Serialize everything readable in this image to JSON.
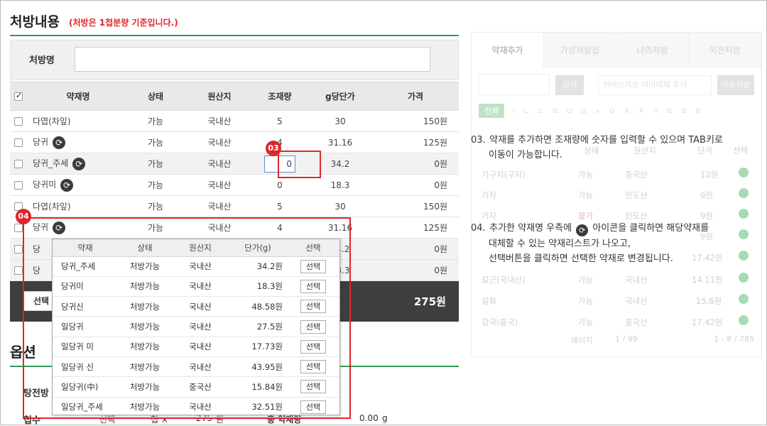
{
  "header": {
    "title": "처방내용",
    "note": "(처방은 1첩분량 기준입니다.)"
  },
  "name_field": {
    "label": "처방명",
    "value": ""
  },
  "table": {
    "columns": [
      "약재명",
      "상태",
      "원산지",
      "조재량",
      "g당단가",
      "가격"
    ],
    "rows": [
      {
        "name": "다엽(차잎)",
        "status": "가능",
        "origin": "국내산",
        "amount": "5",
        "unit_price": "30",
        "price": "150원"
      },
      {
        "name": "당귀",
        "status": "가능",
        "origin": "국내산",
        "amount": "4",
        "unit_price": "31.16",
        "price": "125원"
      },
      {
        "name": "당귀_주세",
        "status": "가능",
        "origin": "국내산",
        "amount": "0",
        "unit_price": "34.2",
        "price": "0원"
      },
      {
        "name": "당귀미",
        "status": "가능",
        "origin": "국내산",
        "amount": "0",
        "unit_price": "18.3",
        "price": "0원"
      },
      {
        "name": "다엽(차잎)",
        "status": "가능",
        "origin": "국내산",
        "amount": "5",
        "unit_price": "30",
        "price": "150원"
      },
      {
        "name": "당귀",
        "status": "가능",
        "origin": "국내산",
        "amount": "4",
        "unit_price": "31.16",
        "price": "125원"
      },
      {
        "name": "당",
        "status": "",
        "origin": "",
        "amount": "",
        "unit_price": "34.2",
        "price": "0원"
      },
      {
        "name": "당",
        "status": "",
        "origin": "",
        "amount": "",
        "unit_price": "18.3",
        "price": "0원"
      }
    ]
  },
  "total_bar": {
    "select_label": "선택",
    "total": "275원"
  },
  "popup": {
    "columns": [
      "약재",
      "상태",
      "원산지",
      "단가(g)",
      "선택"
    ],
    "rows": [
      {
        "name": "당귀_주세",
        "status": "처방가능",
        "origin": "국내산",
        "price": "34.2원",
        "button": "선택"
      },
      {
        "name": "당귀미",
        "status": "처방가능",
        "origin": "국내산",
        "price": "18.3원",
        "button": "선택"
      },
      {
        "name": "당귀신",
        "status": "처방가능",
        "origin": "국내산",
        "price": "48.58원",
        "button": "선택"
      },
      {
        "name": "일당귀",
        "status": "처방가능",
        "origin": "국내산",
        "price": "27.5원",
        "button": "선택"
      },
      {
        "name": "일당귀 미",
        "status": "처방가능",
        "origin": "국내산",
        "price": "17.73원",
        "button": "선택"
      },
      {
        "name": "일당귀 신",
        "status": "처방가능",
        "origin": "국내산",
        "price": "43.95원",
        "button": "선택"
      },
      {
        "name": "일당귀(中)",
        "status": "처방가능",
        "origin": "중국산",
        "price": "15.84원",
        "button": "선택"
      },
      {
        "name": "일당귀_주세",
        "status": "처방가능",
        "origin": "국내산",
        "price": "32.51원",
        "button": "선택"
      }
    ]
  },
  "options": {
    "title": "옵션",
    "decoction_label": "탕전방",
    "count_label": "첩수",
    "select_text": "선택",
    "mult_text": "첩 ×",
    "value_275": "275",
    "unit_won": "원",
    "amount_label": "총 약재량",
    "amount_value": "0.00",
    "amount_unit": "g"
  },
  "annotations": {
    "badge_03": "03",
    "badge_04": "04"
  },
  "notes": {
    "note03": {
      "number": "03.",
      "line1": "약재를 추가하면 조재량에 숫자를 입력할 수 있으며 TAB키로",
      "line2": "이동이 가능합니다."
    },
    "note04": {
      "number": "04.",
      "line1_a": "추가한 약재명 우측에",
      "line1_b": "아이콘을 클릭하면 해당약재를",
      "line2": "대체할 수 있는 약재리스트가 나오고,",
      "line3": "선택버튼을 클릭하면 선택한 약재로 변경됩니다."
    }
  },
  "side_panel": {
    "tabs": [
      "약재추가",
      "가성처방집",
      "나의처방",
      "이전처방"
    ],
    "search_button": "검색",
    "search_placeholder": "띄어쓰기로 여러약재 추가",
    "direct_button": "바로처방",
    "alpha_all": "전체",
    "alphabet": [
      "ㄱ",
      "ㄴ",
      "ㄷ",
      "ㄹ",
      "ㅁ",
      "ㅂ",
      "ㅅ",
      "ㅇ",
      "ㅈ",
      "ㅊ",
      "ㅋ",
      "ㅌ",
      "ㅍ",
      "ㅎ"
    ],
    "list_header": [
      "상태",
      "원산지",
      "단가",
      "선택"
    ],
    "rows": [
      {
        "name": "가구자(구자)",
        "status": "가능",
        "origin": "중국산",
        "price": "12원"
      },
      {
        "name": "가자",
        "status": "가능",
        "origin": "인도산",
        "price": "9원"
      },
      {
        "name": "가자",
        "status": "불가",
        "origin": "인도산",
        "price": "9원"
      },
      {
        "name": "",
        "status": "",
        "origin": "",
        "price": "9원"
      },
      {
        "name": "",
        "status": "",
        "origin": "",
        "price": "17.42원"
      },
      {
        "name": "갈근(국내산)",
        "status": "가능",
        "origin": "국내산",
        "price": "14.11원"
      },
      {
        "name": "갈화",
        "status": "가능",
        "origin": "국내산",
        "price": "15.6원"
      },
      {
        "name": "감국(중국)",
        "status": "가능",
        "origin": "중국산",
        "price": "17.42원"
      }
    ],
    "page_label": "페이지",
    "page_info": "1 / 99",
    "range_info": "1 - 8 / 785"
  }
}
